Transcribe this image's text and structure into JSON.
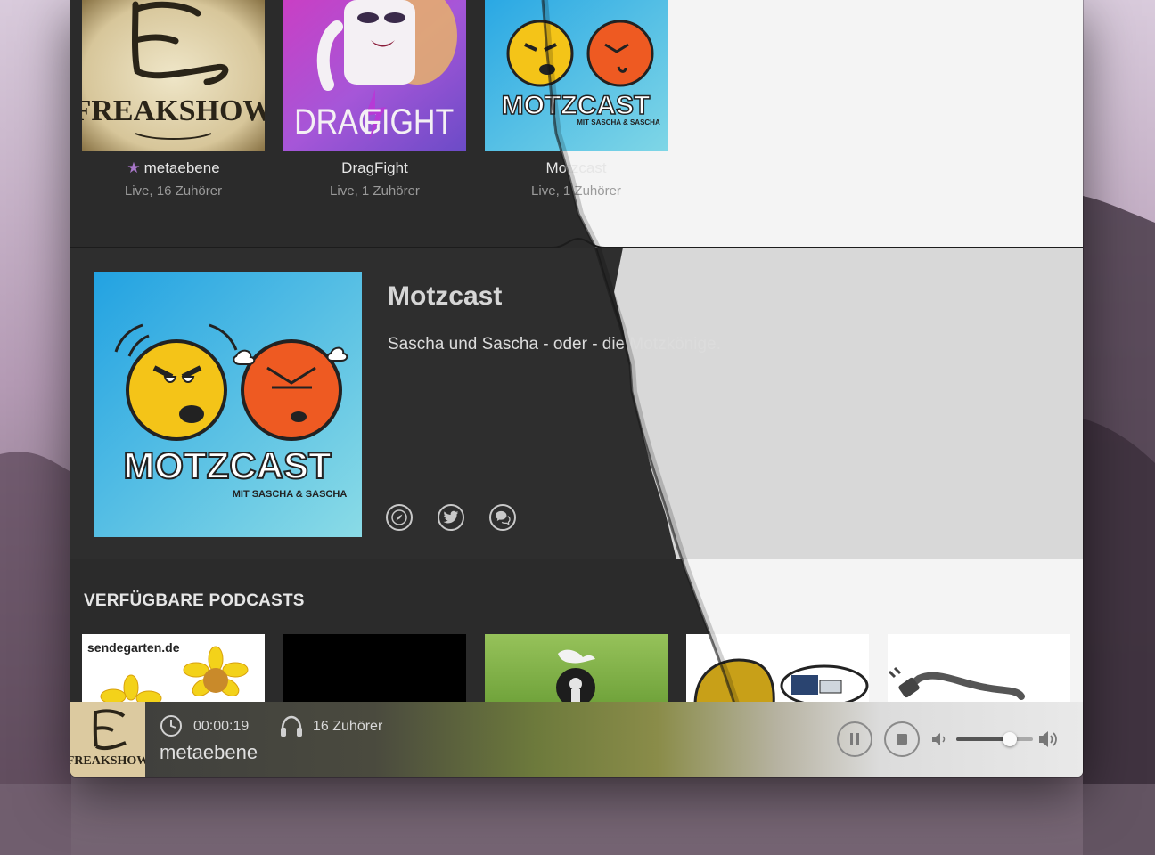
{
  "featured": [
    {
      "title": "metaebene",
      "starred": true,
      "subtitle": "Live, 16 Zuhörer",
      "cover_text": "FREAKSHOW"
    },
    {
      "title": "DragFight",
      "starred": false,
      "subtitle": "Live, 1 Zuhörer",
      "cover_text_left": "DRAG",
      "cover_text_right": "FIGHT"
    },
    {
      "title": "Motzcast",
      "starred": false,
      "subtitle": "Live, 1 Zuhörer",
      "cover_text": "MOTZCAST",
      "cover_small": "MIT SASCHA & SASCHA"
    }
  ],
  "detail": {
    "title": "Motzcast",
    "description": "Sascha und Sascha - oder - die Motzkönige.",
    "cover_text": "MOTZCAST",
    "cover_small": "MIT SASCHA & SASCHA",
    "icons": [
      "compass-icon",
      "twitter-icon",
      "chat-icon"
    ]
  },
  "available": {
    "heading": "VERFÜGBARE PODCASTS",
    "tiles": [
      {
        "label": "sendegarten.de"
      },
      {
        "label": ""
      },
      {
        "label": ""
      },
      {
        "label": ""
      },
      {
        "label": ""
      }
    ]
  },
  "player": {
    "cover_text": "FREAKSHOW",
    "time": "00:00:19",
    "listeners": "16 Zuhörer",
    "title": "metaebene",
    "volume": 0.7
  },
  "colors": {
    "dark_bg": "#2b2b2b",
    "light_bg": "#f4f4f4",
    "star": "#a776c8",
    "motzcast_bg": "#3fb6e6"
  }
}
